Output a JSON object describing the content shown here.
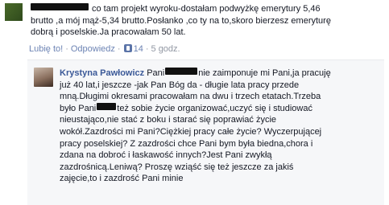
{
  "top_comment": {
    "text_line1_after": "co tam projekt wyroku-dostałam podwyżkę emerytury 5,46",
    "text_line2": "brutto ,a mój mąż-5,34 brutto.Posłanko ,co ty na to,skoro bierzesz emeryturę",
    "text_line3": "dobrą i poselskie.Ja pracowałam 50 lat.",
    "actions": {
      "like_label": "Lubię to!",
      "reply_label": "Odpowiedz",
      "like_count": "14",
      "time": "5 godz."
    }
  },
  "reply": {
    "author": "Krystyna Pawłowicz",
    "seg1": "Pani",
    "seg2": "nie zaimponuje mi Pani,ja pracuję",
    "line2": "już 40 lat,i jeszcze -jak Pan Bóg da - długie lata pracy przede",
    "line3": "mną.Długimi okresami pracowałam na dwu i trzech etatach.Trzeba",
    "line4_a": "było Pani",
    "line4_b": "też sobie życie organizować,uczyć się i studiować",
    "line5": "nieustająco,nie stać z boku i starać się poprawiać życie",
    "line6": "wokół.Zazdrości mi Pani?Ciężkiej pracy całe życie? Wyczerpującej",
    "line7": "pracy poselskiej? Z zazdrości chce Pani bym była biedna,chora i",
    "line8": "zdana na dobroć i łaskawość innych?Jest Pani zwykłą",
    "line9": "zazdrośnicą.Leniwą? Proszę wziąść się też jeszcze za jakiś",
    "line10": "zajęcie,to i zazdrość Pani minie"
  },
  "colors": {
    "link": "#3b5998",
    "meta": "#9197a3",
    "reply_bg": "#f6f7f9"
  }
}
